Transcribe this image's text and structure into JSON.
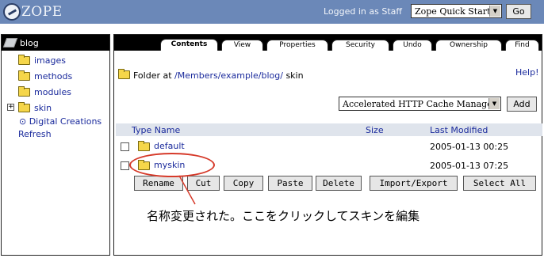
{
  "app": {
    "logo_text": "ZOPE",
    "logged_in_text": "Logged in as Staff",
    "quick_start_selected": "Zope Quick Start",
    "go_label": "Go"
  },
  "tree": {
    "root_label": "blog",
    "items": [
      {
        "label": "images"
      },
      {
        "label": "methods"
      },
      {
        "label": "modules"
      },
      {
        "label": "skin"
      }
    ],
    "expand_glyph": "+",
    "digital_creations": "⊙ Digital Creations",
    "refresh": "Refresh"
  },
  "tabs": [
    {
      "label": "Contents",
      "active": true
    },
    {
      "label": "View"
    },
    {
      "label": "Properties"
    },
    {
      "label": "Security"
    },
    {
      "label": "Undo"
    },
    {
      "label": "Ownership"
    },
    {
      "label": "Find"
    }
  ],
  "location": {
    "prefix": "Folder at ",
    "path": "/Members/example/blog/",
    "current": "skin",
    "help": "Help!"
  },
  "add": {
    "selected": "Accelerated HTTP Cache Manager",
    "button": "Add"
  },
  "list": {
    "headers": {
      "type_name": "Type Name",
      "size": "Size",
      "last_modified": "Last Modified"
    },
    "rows": [
      {
        "name": "default",
        "modified": "2005-01-13 00:25"
      },
      {
        "name": "myskin",
        "modified": "2005-01-13 07:25"
      }
    ]
  },
  "actions": [
    "Rename",
    "Cut",
    "Copy",
    "Paste",
    "Delete",
    "Import/Export",
    "Select All"
  ],
  "annotation": {
    "text": "名称変更された。ここをクリックしてスキンを編集",
    "color": "#d63a2a"
  }
}
